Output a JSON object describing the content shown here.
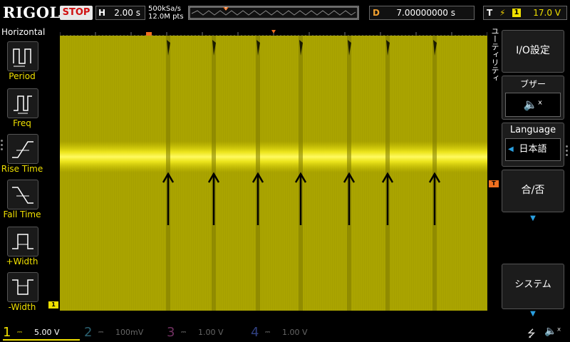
{
  "header": {
    "brand": "RIGOL",
    "run_state": "STOP",
    "timebase_label": "H",
    "timebase_value": "2.00 s",
    "sample_rate": "500kSa/s",
    "memory_depth": "12.0M pts",
    "delay_label": "D",
    "delay_value": "7.00000000 s",
    "trigger_label": "T",
    "trigger_source": "1",
    "trigger_level": "17.0 V"
  },
  "left_menu": {
    "title": "Horizontal",
    "items": [
      {
        "label": "Period",
        "icon": "period-icon"
      },
      {
        "label": "Freq",
        "icon": "freq-icon"
      },
      {
        "label": "Rise Time",
        "icon": "rise-time-icon"
      },
      {
        "label": "Fall Time",
        "icon": "fall-time-icon"
      },
      {
        "label": "+Width",
        "icon": "pos-width-icon"
      },
      {
        "label": "-Width",
        "icon": "neg-width-icon"
      }
    ]
  },
  "right_menu": {
    "tab_label": "ユーティリティ",
    "io_settings": "I/O設定",
    "buzzer_label": "ブザー",
    "buzzer_icon": "speaker-mute-icon",
    "language_label": "Language",
    "language_value": "日本語",
    "pass_fail": "合/否",
    "system": "システム"
  },
  "channels": [
    {
      "num": "1",
      "value": "5.00 V",
      "color": "#f0e000",
      "active": true
    },
    {
      "num": "2",
      "value": "100mV",
      "color": "#00c0f0",
      "active": false
    },
    {
      "num": "3",
      "value": "1.00 V",
      "color": "#e040c0",
      "active": false
    },
    {
      "num": "4",
      "value": "1.00 V",
      "color": "#2060f0",
      "active": false
    }
  ],
  "markers": {
    "ch1_marker": "1",
    "trigger_marker": "T"
  },
  "colors": {
    "screen_bg": "#a6a000",
    "trace": "#f0e000",
    "ch1": "#f0e000",
    "accent_blue": "#2a9fe0",
    "stop": "#d01010"
  },
  "status_icons": [
    "usb-icon",
    "speaker-mute-icon"
  ]
}
